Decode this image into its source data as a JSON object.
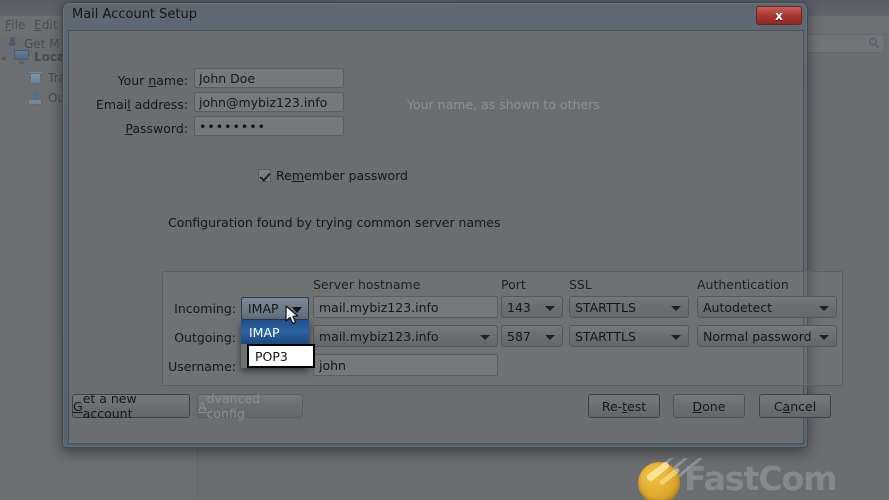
{
  "background": {
    "menus": [
      {
        "name": "file",
        "label": "File",
        "accel": "F"
      },
      {
        "name": "edit",
        "label": "Edit",
        "accel": "E"
      }
    ],
    "toolbar": {
      "get_mail_label": "Get M",
      "get_mail_icon": "download-icon"
    },
    "search": {
      "icon": "search-icon"
    },
    "folder_tree": [
      {
        "name": "local-folders",
        "label": "Local",
        "icon": "monitor-icon"
      },
      {
        "name": "trash",
        "label": "Tras",
        "icon": "trash-icon"
      },
      {
        "name": "outbox",
        "label": "Outl",
        "icon": "outbox-icon"
      }
    ]
  },
  "watermark": {
    "text": "FastCom"
  },
  "dialog": {
    "title": "Mail Account Setup",
    "close_label": "x",
    "close_icon": "close-icon",
    "fields": {
      "name": {
        "label": "Your ",
        "label_accel": "n",
        "label_tail": "ame:",
        "value": "John Doe",
        "hint": "Your name, as shown to others"
      },
      "email": {
        "label_head": "Emai",
        "label_accel": "l",
        "label_tail": " address:",
        "value": "john@mybiz123.info"
      },
      "password": {
        "label_accel": "P",
        "label_tail": "assword:",
        "value": "••••••••",
        "masked_value": "••••••••"
      }
    },
    "remember_password": {
      "label_head": "Re",
      "label_accel": "m",
      "label_tail": "ember password",
      "checked": true
    },
    "status_text": "Configuration found by trying common server names",
    "server_table": {
      "headers": {
        "hostname": "Server hostname",
        "port": "Port",
        "ssl": "SSL",
        "auth": "Authentication"
      },
      "rows": [
        {
          "name": "incoming",
          "label": "Incoming:",
          "protocol": "IMAP",
          "hostname": "mail.mybiz123.info",
          "port": "143",
          "ssl": "STARTTLS",
          "auth": "Autodetect"
        },
        {
          "name": "outgoing",
          "label": "Outgoing:",
          "hostname": "mail.mybiz123.info",
          "port": "587",
          "ssl": "STARTTLS",
          "auth": "Normal password"
        }
      ],
      "username": {
        "label": "Username:",
        "value": "john"
      }
    },
    "protocol_dropdown": {
      "open": true,
      "selected": "IMAP",
      "options": [
        "IMAP",
        "POP3"
      ]
    },
    "buttons": {
      "get_new_account": {
        "head": "",
        "accel": "G",
        "tail": "et a new account",
        "disabled": false
      },
      "advanced_config": {
        "head": "",
        "accel": "A",
        "tail": "dvanced config",
        "disabled": true
      },
      "retest": {
        "head": "Re-",
        "accel": "t",
        "tail": "est",
        "disabled": false
      },
      "done": {
        "head": "",
        "accel": "D",
        "tail": "one",
        "disabled": false
      },
      "cancel": {
        "head": "C",
        "accel": "a",
        "tail": "ncel",
        "disabled": false
      }
    }
  },
  "colors": {
    "dialog_chrome": "#58676f",
    "dialog_body": "#6b6e70",
    "close_red": "#ab3a33",
    "dropdown_highlight": "#2a63a4",
    "watermark_orange": "#e0a830"
  }
}
